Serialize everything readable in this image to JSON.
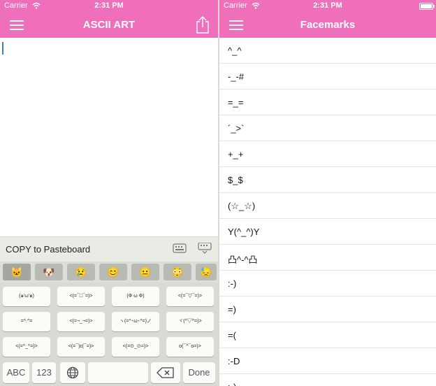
{
  "left_screen": {
    "status": {
      "carrier": "Carrier",
      "time": "2:31 PM"
    },
    "nav": {
      "title": "ASCII ART",
      "menu_icon": "hamburger-menu-icon",
      "share_icon": "share-icon"
    },
    "pasteboard": {
      "label": "COPY to Pasteboard",
      "icons": [
        "keyboard-icon",
        "keyboard-dismiss-icon"
      ]
    },
    "emoji_tabs": [
      "🐱",
      "🐶",
      "😢",
      "😊",
      "😐",
      "😳",
      "😓"
    ],
    "kaomoji_rows": [
      [
        "(๑'ω'๑)",
        "<(=¯□¯=)>",
        "(Φ ω Φ)",
        "<(=¯▽¯=)>"
      ],
      [
        "=^.^=",
        "<(=¬_¬=)>",
        "ヽ(=^･ω･^=)ノ",
        "ヾ(^▽^=)>"
      ],
      [
        "<(=^_^=)>",
        "<(=¯)ε(¯=)>",
        "<(=⊙_⊙=)>",
        "o(¯^¯o=)>"
      ]
    ],
    "bottom_keys": {
      "abc": "ABC",
      "num": "123",
      "globe": "globe-icon",
      "space": "",
      "delete": "delete-icon",
      "done": "Done"
    }
  },
  "right_screen": {
    "status": {
      "carrier": "Carrier",
      "time": "2:31 PM"
    },
    "nav": {
      "title": "Facemarks",
      "menu_icon": "hamburger-menu-icon"
    },
    "items": [
      "^_^",
      "-_-#",
      "=_=",
      "´_>`",
      "+_+",
      "$_$",
      "(☆_☆)",
      "Y(^_^)Y",
      "凸^-^凸",
      ":-)",
      "=)",
      "=(",
      ":-D",
      ":-)"
    ]
  },
  "colors": {
    "accent": "#f06fba",
    "keyboard_bg": "#d8dbd3",
    "key_bg": "#fbfbf7"
  }
}
